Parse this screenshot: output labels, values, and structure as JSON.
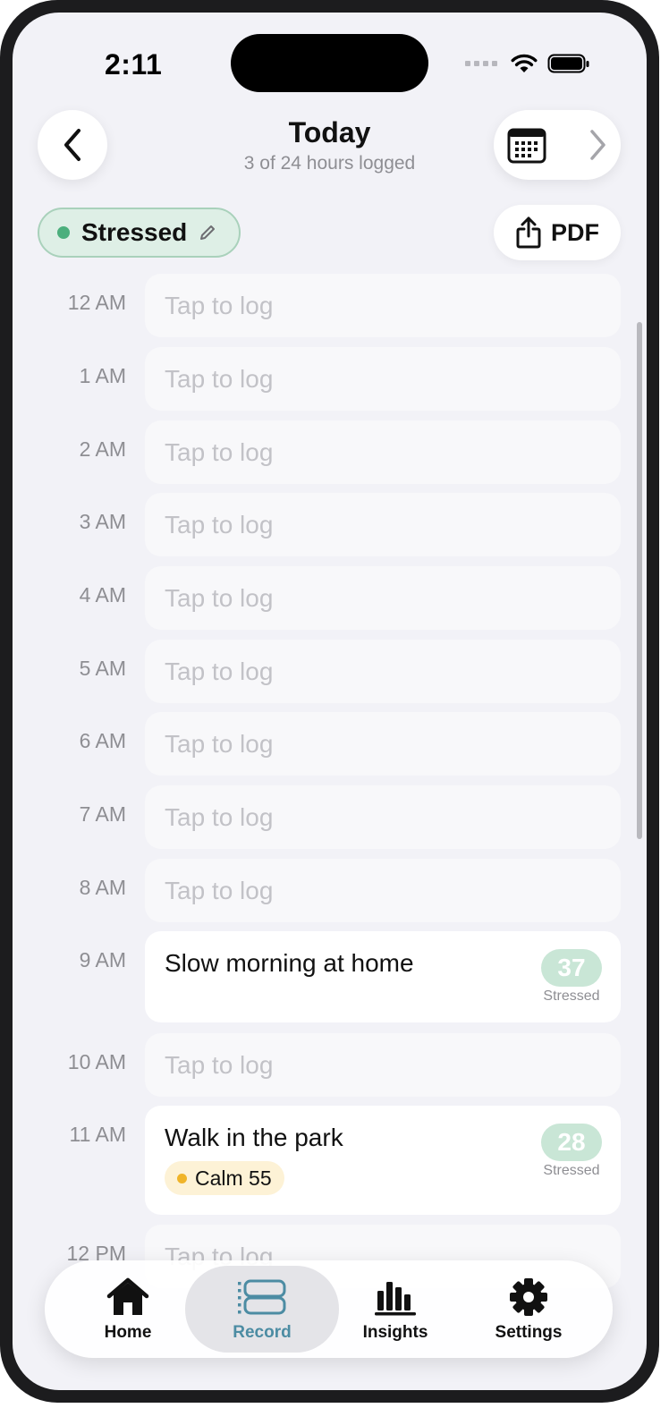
{
  "status_bar": {
    "time": "2:11"
  },
  "header": {
    "title": "Today",
    "subtitle": "3 of 24 hours logged"
  },
  "mood": {
    "label": "Stressed",
    "dot_color": "#4caf7d"
  },
  "export": {
    "label": "PDF"
  },
  "slots": [
    {
      "hour": "12 AM",
      "placeholder": "Tap to log"
    },
    {
      "hour": "1 AM",
      "placeholder": "Tap to log"
    },
    {
      "hour": "2 AM",
      "placeholder": "Tap to log"
    },
    {
      "hour": "3 AM",
      "placeholder": "Tap to log"
    },
    {
      "hour": "4 AM",
      "placeholder": "Tap to log"
    },
    {
      "hour": "5 AM",
      "placeholder": "Tap to log"
    },
    {
      "hour": "6 AM",
      "placeholder": "Tap to log"
    },
    {
      "hour": "7 AM",
      "placeholder": "Tap to log"
    },
    {
      "hour": "8 AM",
      "placeholder": "Tap to log"
    },
    {
      "hour": "9 AM",
      "title": "Slow morning at home",
      "score": "37",
      "score_label": "Stressed"
    },
    {
      "hour": "10 AM",
      "placeholder": "Tap to log"
    },
    {
      "hour": "11 AM",
      "title": "Walk in the park",
      "score": "28",
      "score_label": "Stressed",
      "tag": {
        "label": "Calm 55",
        "color": "#f0b429"
      }
    },
    {
      "hour": "12 PM",
      "placeholder": "Tap to log"
    }
  ],
  "tabs": [
    {
      "label": "Home",
      "icon": "home-icon"
    },
    {
      "label": "Record",
      "icon": "record-icon",
      "active": true
    },
    {
      "label": "Insights",
      "icon": "bar-chart-icon"
    },
    {
      "label": "Settings",
      "icon": "gear-icon"
    }
  ],
  "colors": {
    "accent": "#4c8ca3",
    "stressed": "#4caf7d",
    "score_badge": "#c9e6d6"
  }
}
